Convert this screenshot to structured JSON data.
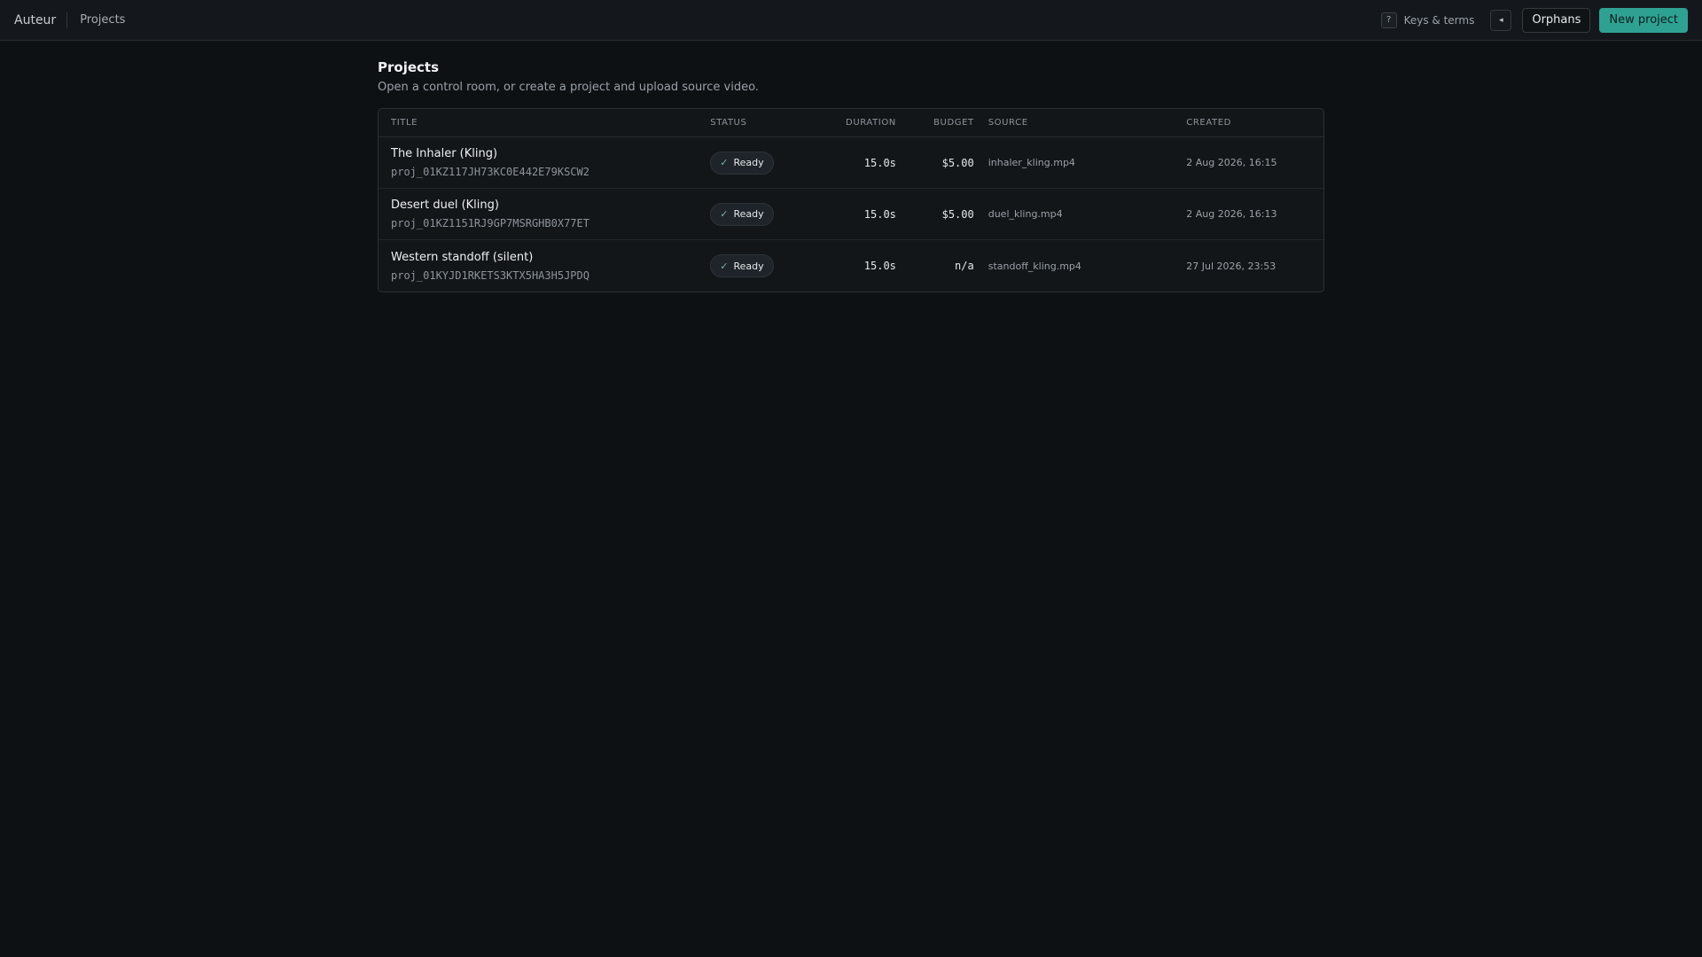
{
  "topbar": {
    "brand": "Auteur",
    "crumb": "Projects",
    "help_icon": "?",
    "help_label": "Keys & terms",
    "collapse_icon": "◂",
    "orphans_label": "Orphans",
    "new_project_label": "New project",
    "accent": "#2fa193"
  },
  "page": {
    "title": "Projects",
    "subtitle": "Open a control room, or create a project and upload source video."
  },
  "table": {
    "headers": {
      "title": "TITLE",
      "status": "STATUS",
      "duration": "DURATION",
      "budget": "BUDGET",
      "source": "SOURCE",
      "created": "CREATED"
    },
    "rows": [
      {
        "name": "The Inhaler (Kling)",
        "id": "proj_01KZ117JH73KC0E442E79KSCW2",
        "status": "Ready",
        "duration": "15.0s",
        "budget": "$5.00",
        "source": "inhaler_kling.mp4",
        "created": "2 Aug 2026, 16:15"
      },
      {
        "name": "Desert duel (Kling)",
        "id": "proj_01KZ1151RJ9GP7MSRGHB0X77ET",
        "status": "Ready",
        "duration": "15.0s",
        "budget": "$5.00",
        "source": "duel_kling.mp4",
        "created": "2 Aug 2026, 16:13"
      },
      {
        "name": "Western standoff (silent)",
        "id": "proj_01KYJD1RKETS3KTX5HA3H5JPDQ",
        "status": "Ready",
        "duration": "15.0s",
        "budget": "n/a",
        "source": "standoff_kling.mp4",
        "created": "27 Jul 2026, 23:53"
      }
    ]
  }
}
